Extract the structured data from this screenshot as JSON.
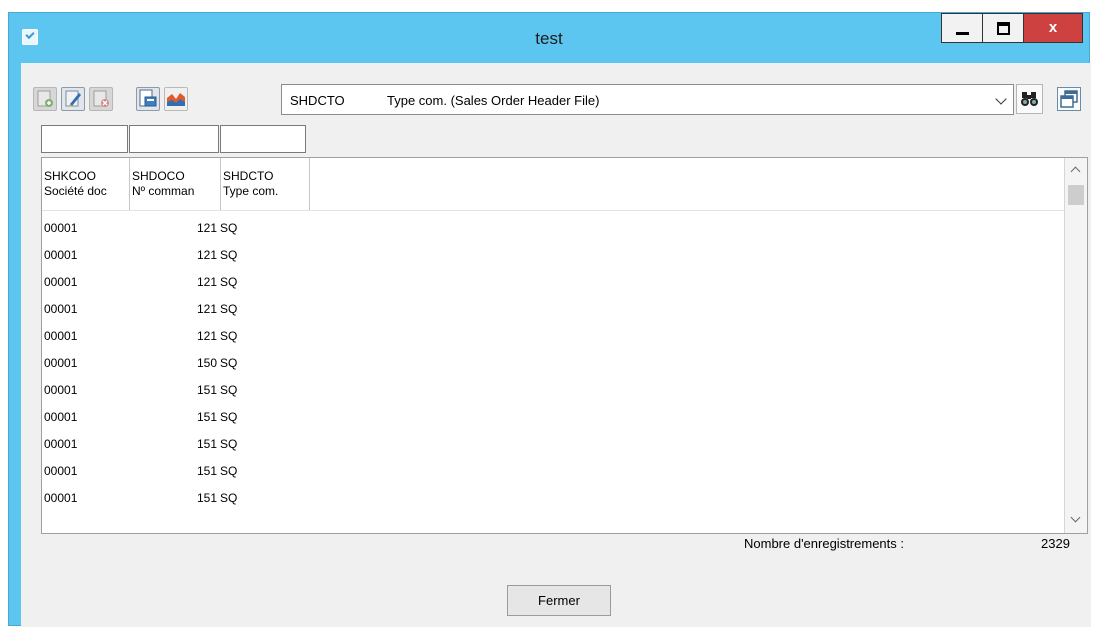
{
  "window": {
    "title": "test"
  },
  "window_controls": {
    "close": "x"
  },
  "toolbar": {
    "icons": [
      "add-record-icon",
      "edit-record-icon",
      "delete-record-icon",
      "print-icon",
      "chart-icon"
    ]
  },
  "table_selector": {
    "code": "SHDCTO",
    "description": "Type com. (Sales Order Header File)"
  },
  "grid": {
    "columns": [
      {
        "code": "SHKCOO",
        "label": "Société doc"
      },
      {
        "code": "SHDOCO",
        "label": "Nº comman"
      },
      {
        "code": "SHDCTO",
        "label": "Type com."
      }
    ],
    "rows": [
      [
        "00001",
        "121",
        "SQ"
      ],
      [
        "00001",
        "121",
        "SQ"
      ],
      [
        "00001",
        "121",
        "SQ"
      ],
      [
        "00001",
        "121",
        "SQ"
      ],
      [
        "00001",
        "121",
        "SQ"
      ],
      [
        "00001",
        "150",
        "SQ"
      ],
      [
        "00001",
        "151",
        "SQ"
      ],
      [
        "00001",
        "151",
        "SQ"
      ],
      [
        "00001",
        "151",
        "SQ"
      ],
      [
        "00001",
        "151",
        "SQ"
      ],
      [
        "00001",
        "151",
        "SQ"
      ]
    ]
  },
  "footer": {
    "count_label": "Nombre d'enregistrements :",
    "count_value": "2329",
    "close_label": "Fermer"
  }
}
